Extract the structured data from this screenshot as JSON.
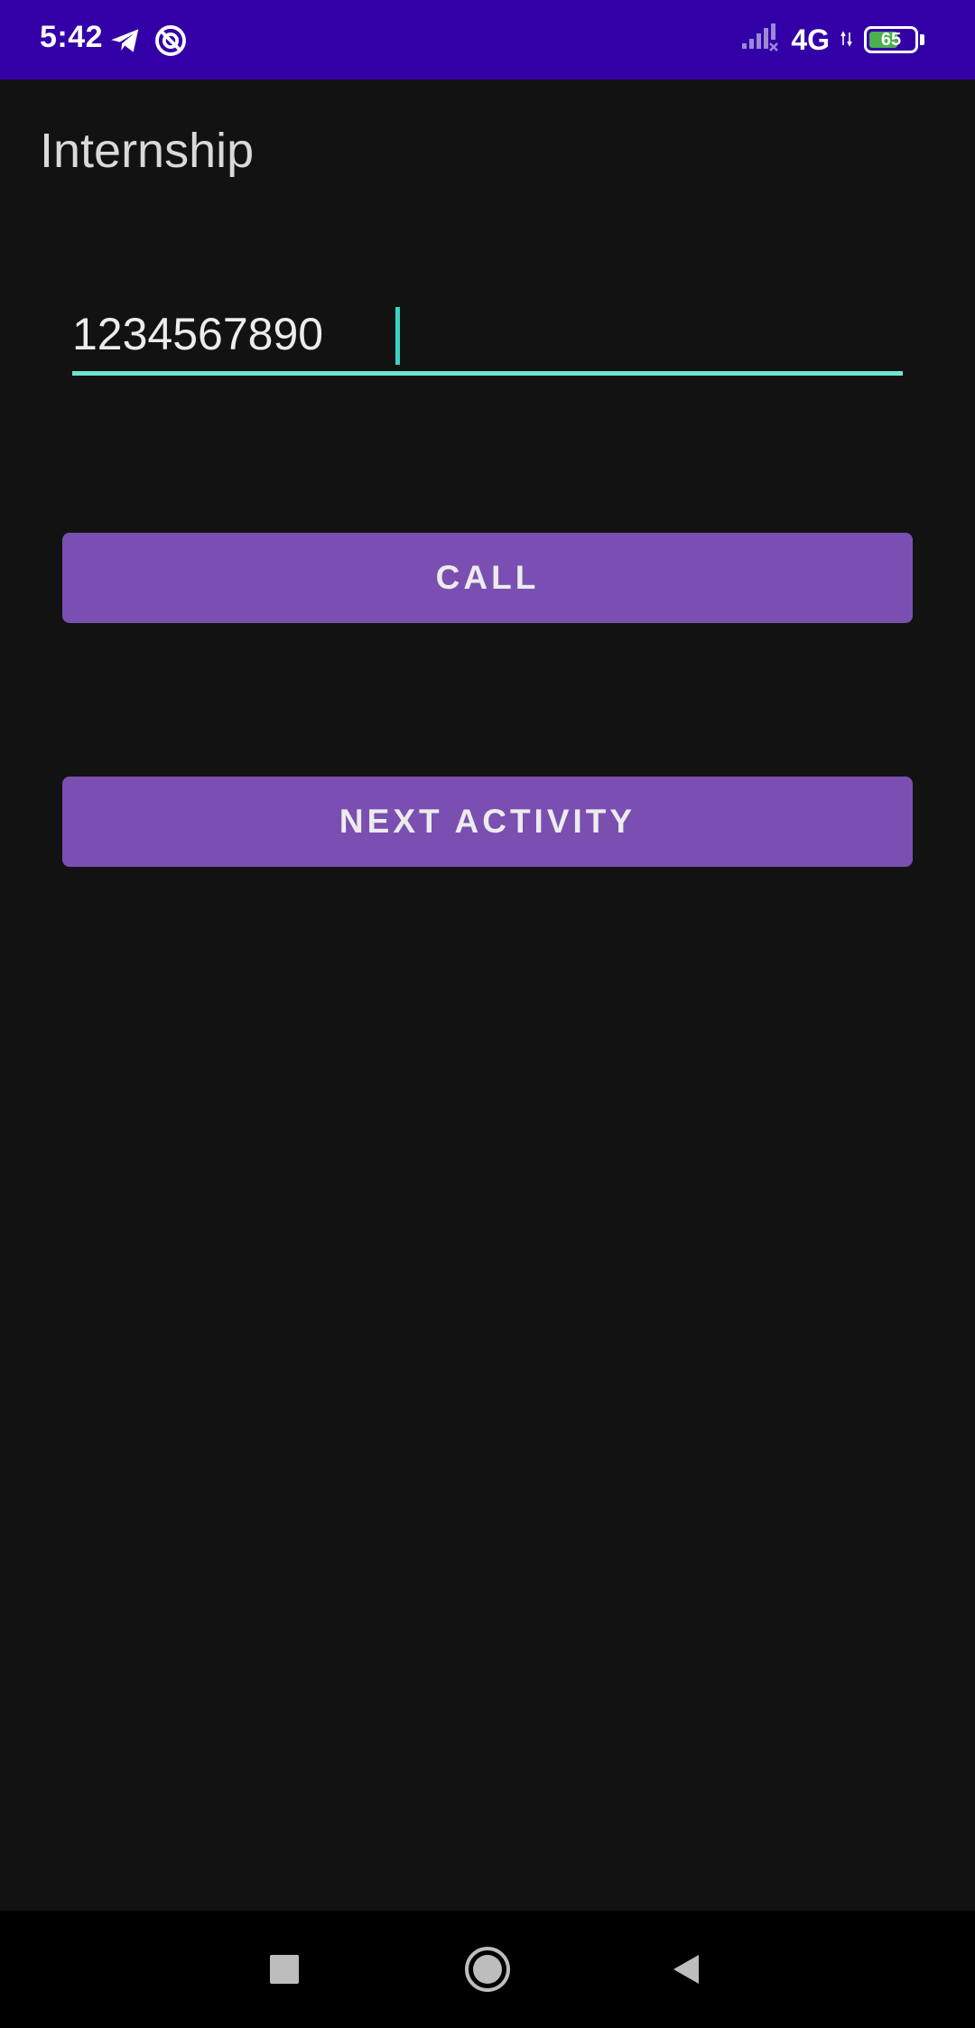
{
  "status_bar": {
    "time": "5:42",
    "network": "4G",
    "battery_level": "65",
    "battery_fraction": 0.65,
    "icons": [
      "telegram-icon",
      "sync-icon",
      "signal-icon",
      "battery-icon"
    ]
  },
  "app_bar": {
    "title": "Internship"
  },
  "phone_input": {
    "value": "1234567890",
    "accent_color": "#6ce4d2"
  },
  "buttons": {
    "call_label": "CALL",
    "next_label": "NEXT ACTIVITY",
    "color": "#7a4fb1"
  },
  "nav_bar": {
    "icons": [
      "recents-icon",
      "home-icon",
      "back-icon"
    ]
  }
}
